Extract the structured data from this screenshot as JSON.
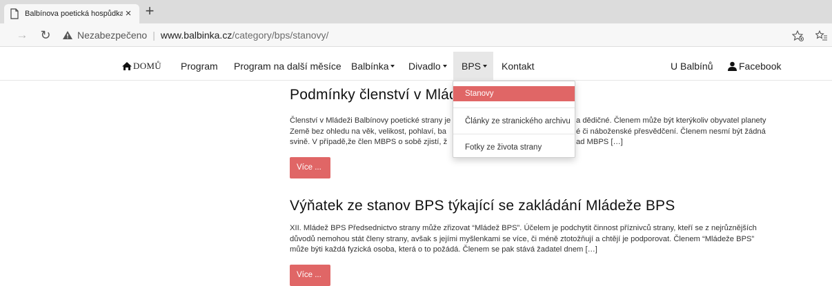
{
  "browser": {
    "tab_title": "Balbínova poetická hospůdka",
    "tab_close": "×",
    "new_tab": "+",
    "insecure_label": "Nezabezpečeno",
    "separator": "|",
    "url_host": "www.balbinka.cz",
    "url_path": "/category/bps/stanovy/"
  },
  "nav": {
    "home": "DOMŮ",
    "program": "Program",
    "program_next": "Program na další měsíce",
    "balbinka": "Balbínka",
    "divadlo": "Divadlo",
    "bps": "BPS",
    "kontakt": "Kontakt",
    "u_balbinu": "U Balbínů",
    "facebook": "Facebook"
  },
  "dropdown": {
    "items": [
      {
        "label": "Stanovy"
      },
      {
        "label": "Články ze stranického archivu"
      },
      {
        "label": "Fotky ze života strany"
      }
    ]
  },
  "posts": [
    {
      "title": "Podmínky členství v Mláde",
      "excerpt_lines": [
        "Členství v Mládeži Balbínovy poetické strany je",
        "Země bez ohledu na věk, velikost, pohlaví, ba",
        "svině. V případě,že člen MBPS o sobě zjistí, ž"
      ],
      "excerpt_tail_lines": [
        "a dědičné. Členem může být kterýkoliv obyvatel planety",
        "é či náboženské přesvědčení. Členem nesmí být žádná",
        "ad MBPS […]"
      ],
      "more": "Více ..."
    },
    {
      "title": "Výňatek ze stanov BPS týkající se zakládání Mládeže BPS",
      "excerpt_lines": [
        "XII. Mládež BPS Předsednictvo strany může zřizovat “Mládež BPS”. Účelem je podchytit činnost příznivců strany, kteří se z nejrůznějších",
        "důvodů nemohou stát členy strany, avšak s jejími myšlenkami se více, či méně ztotožňují a chtějí je podporovat. Členem “Mládeže BPS”",
        "může býti každá fyzická osoba, která o to požádá. Členem se pak stává žadatel dnem […]"
      ],
      "more": "Více ..."
    }
  ],
  "colors": {
    "accent": "#e06666",
    "text": "#222222"
  }
}
